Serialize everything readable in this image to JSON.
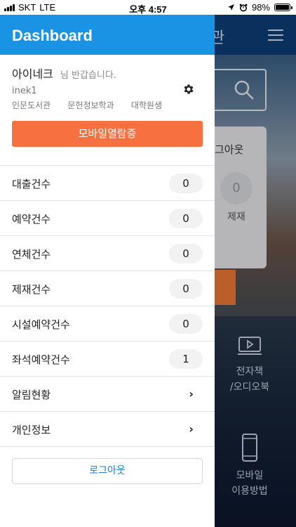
{
  "status_bar": {
    "carrier": "SKT",
    "network": "LTE",
    "time": "오후 4:57",
    "battery": "98%"
  },
  "background": {
    "title_fragment": "관",
    "card_title": "그아웃",
    "card_count": "0",
    "card_label": "제재",
    "feature_ebook": [
      "전자책",
      "/오디오북"
    ],
    "feature_mobile": [
      "모바일",
      "이용방법"
    ]
  },
  "drawer": {
    "title": "Dashboard",
    "profile": {
      "name": "아이네크",
      "greeting": "님 반갑습니다.",
      "user_id": "inek1",
      "library": "인문도서관",
      "department": "문헌정보학과",
      "status": "대학원생"
    },
    "mobile_card_button": "모바일열람증",
    "stats": [
      {
        "label": "대출건수",
        "value": "0"
      },
      {
        "label": "예약건수",
        "value": "0"
      },
      {
        "label": "연체건수",
        "value": "0"
      },
      {
        "label": "제재건수",
        "value": "0"
      },
      {
        "label": "시설예약건수",
        "value": "0"
      },
      {
        "label": "좌석예약건수",
        "value": "1"
      }
    ],
    "links": [
      {
        "label": "알림현황"
      },
      {
        "label": "개인정보"
      }
    ],
    "logout_button": "로그아웃"
  },
  "colors": {
    "drawer_header": "#1b93e5",
    "mobile_button": "#f77040",
    "app_header": "#0e3f78",
    "logout_text": "#1b7fd0"
  },
  "icons": [
    "signal-icon",
    "location-arrow-icon",
    "alarm-icon",
    "battery-icon",
    "gear-icon",
    "chevron-right-icon",
    "search-icon",
    "hamburger-menu-icon",
    "ebook-player-icon",
    "smartphone-icon"
  ]
}
